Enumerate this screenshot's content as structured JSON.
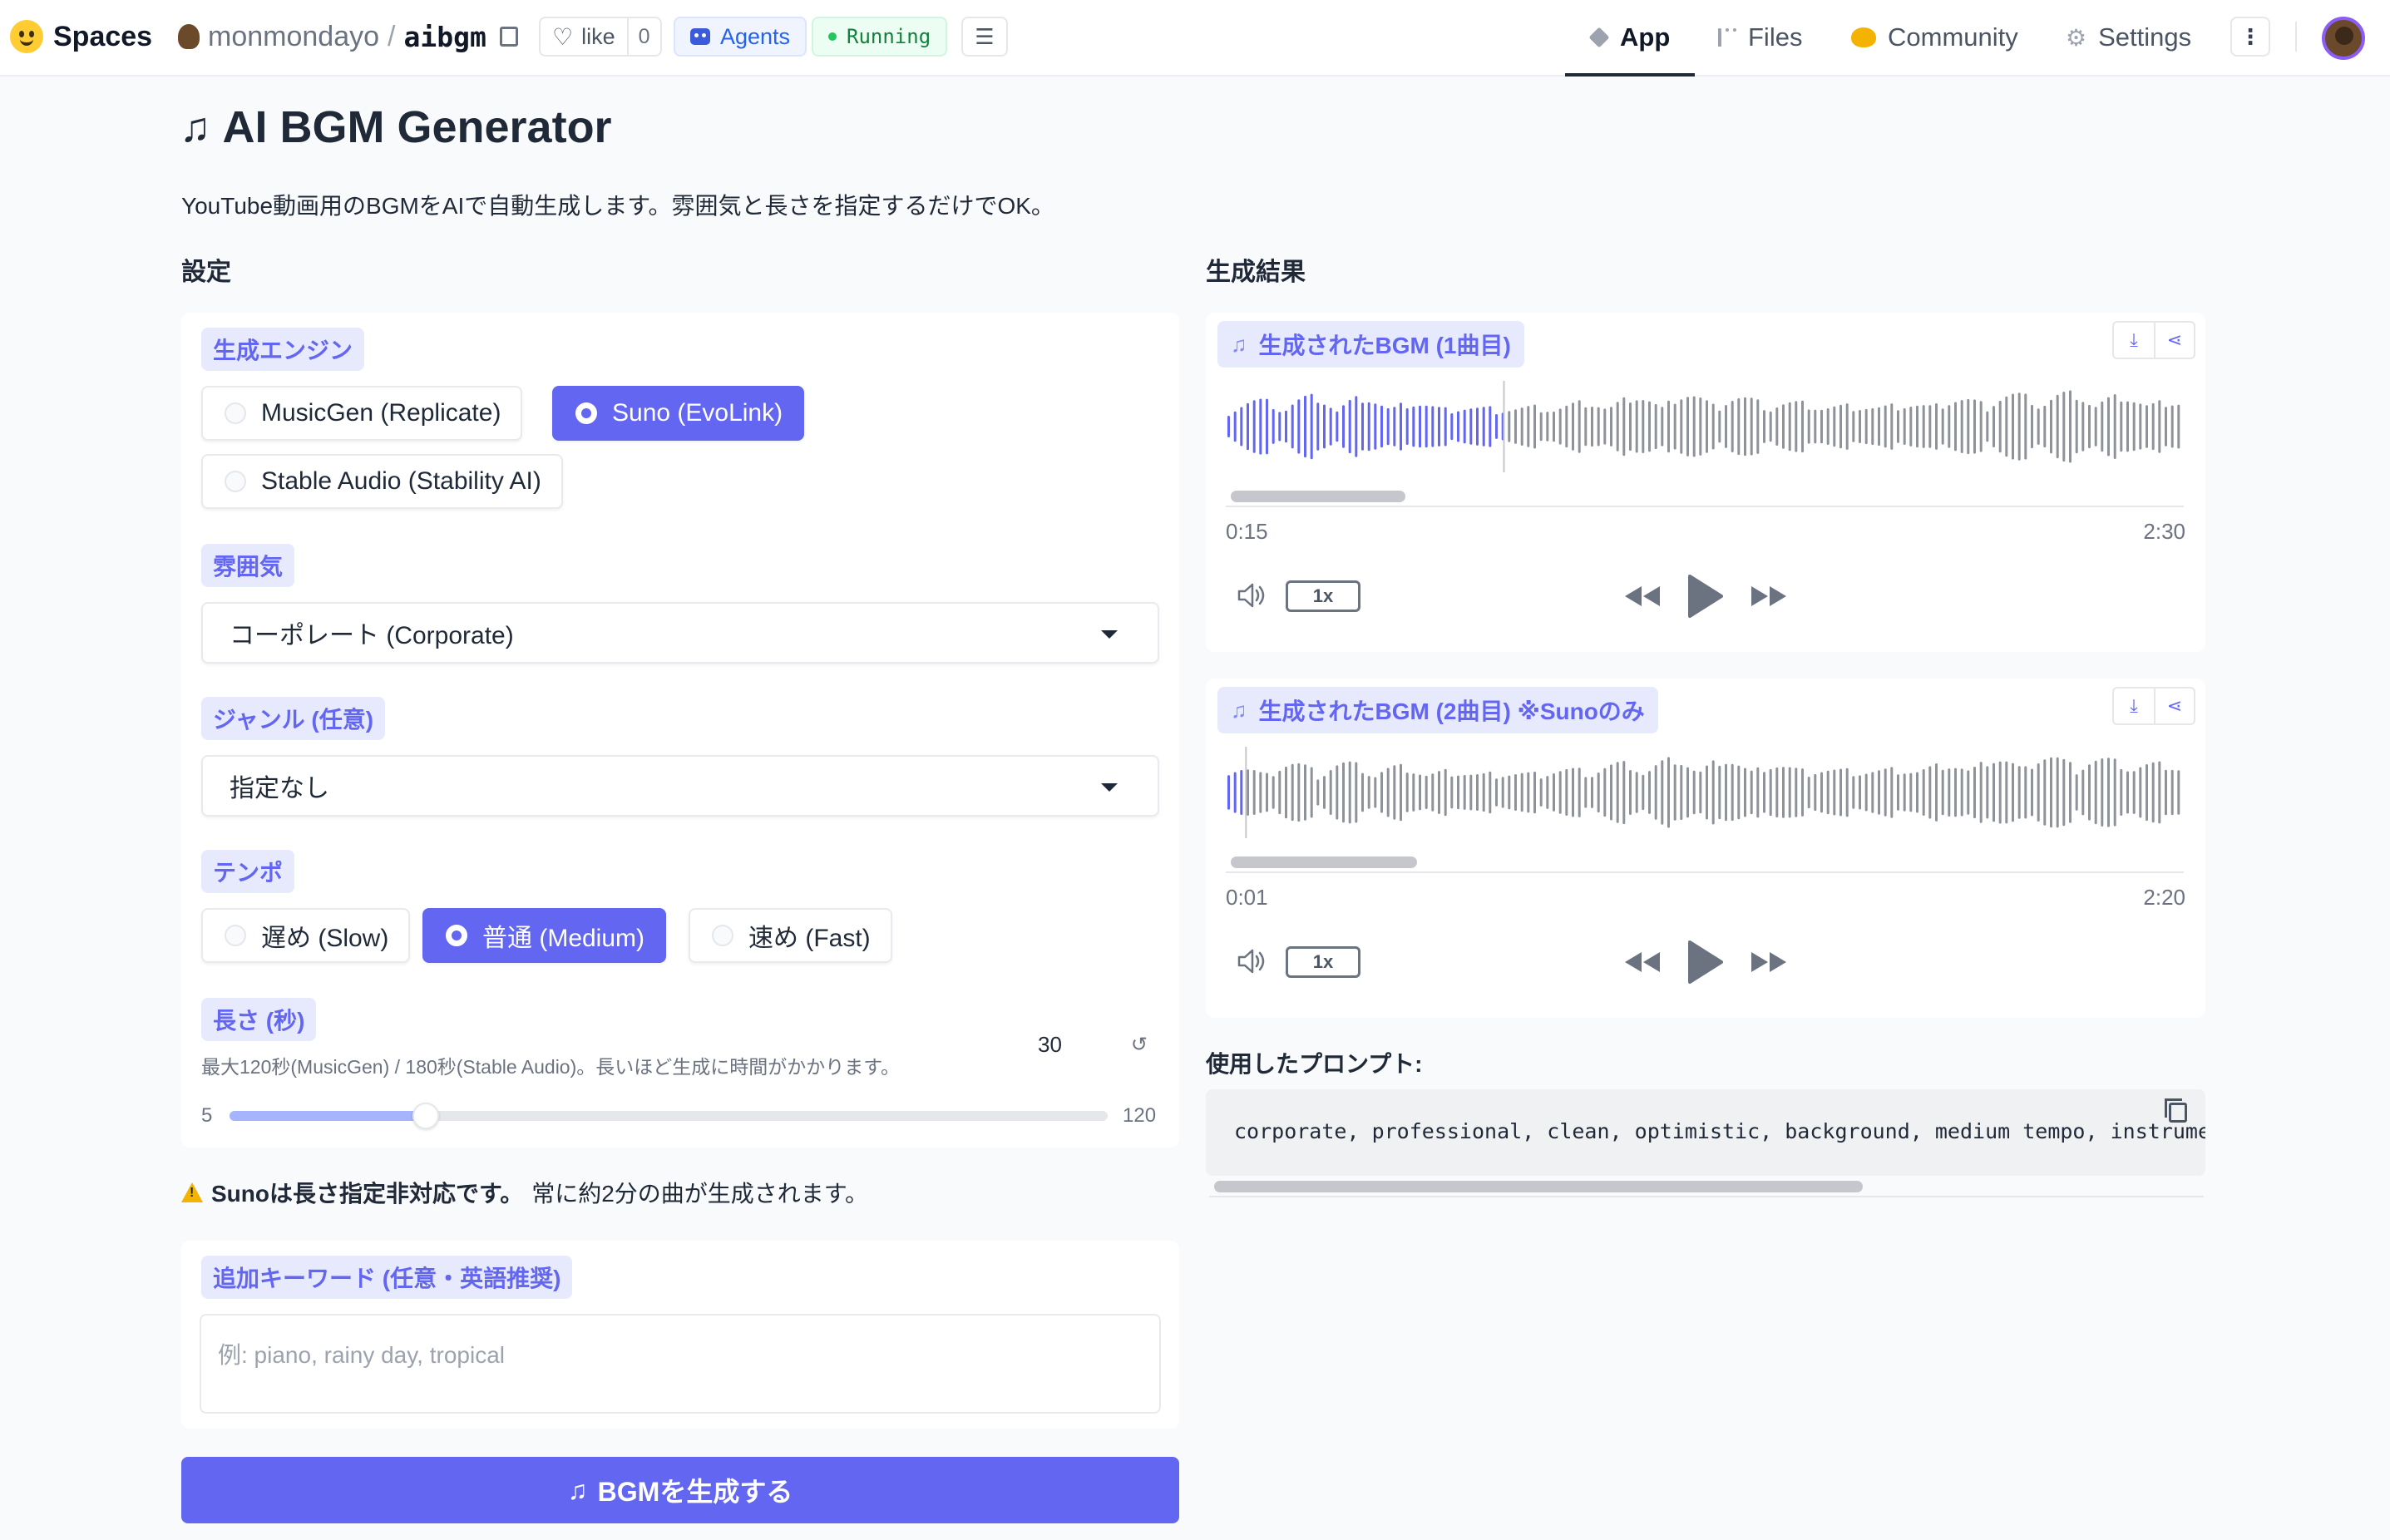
{
  "topbar": {
    "spaces_label": "Spaces",
    "owner": "monmondayo",
    "separator": "/",
    "repo": "aibgm",
    "like_label": "like",
    "like_count": "0",
    "agents_label": "Agents",
    "status": "Running",
    "tabs": [
      {
        "label": "App",
        "icon": "cube-icon"
      },
      {
        "label": "Files",
        "icon": "files-icon"
      },
      {
        "label": "Community",
        "icon": "community-icon"
      },
      {
        "label": "Settings",
        "icon": "gear-icon"
      }
    ],
    "more_label": "⋮"
  },
  "page": {
    "title": "AI BGM Generator",
    "description": "YouTube動画用のBGMをAIで自動生成します。雰囲気と長さを指定するだけでOK。"
  },
  "settings": {
    "heading": "設定",
    "engine": {
      "label": "生成エンジン",
      "options": [
        "MusicGen (Replicate)",
        "Suno (EvoLink)",
        "Stable Audio (Stability AI)"
      ],
      "selected": "Suno (EvoLink)"
    },
    "mood": {
      "label": "雰囲気",
      "value": "コーポレート (Corporate)"
    },
    "genre": {
      "label": "ジャンル (任意)",
      "value": "指定なし"
    },
    "tempo": {
      "label": "テンポ",
      "options": [
        "遅め (Slow)",
        "普通 (Medium)",
        "速め (Fast)"
      ],
      "selected": "普通 (Medium)"
    },
    "length": {
      "label": "長さ (秒)",
      "hint": "最大120秒(MusicGen) / 180秒(Stable Audio)。長いほど生成に時間がかかります。",
      "value": "30",
      "min": "5",
      "max": "120"
    },
    "warning_bold": "Sunoは長さ指定非対応です。",
    "warning_text": "常に約2分の曲が生成されます。",
    "keywords": {
      "label": "追加キーワード (任意・英語推奨)",
      "placeholder": "例: piano, rainy day, tropical"
    },
    "generate_label": "BGMを生成する"
  },
  "results": {
    "heading": "生成結果",
    "players": [
      {
        "label": "生成されたBGM (1曲目)",
        "current": "0:15",
        "duration": "2:30",
        "rate": "1x",
        "progress": 0.1
      },
      {
        "label": "生成されたBGM (2曲目) ※Sunoのみ",
        "current": "0:01",
        "duration": "2:20",
        "rate": "1x",
        "progress": 0.007
      }
    ],
    "prompt_label": "使用したプロンプト:",
    "prompt_text": "corporate, professional, clean, optimistic, background, medium tempo, instrumenta"
  },
  "colors": {
    "accent": "#6366f1",
    "played_wave": "#6366f1",
    "unplayed_wave": "#8e9299"
  }
}
